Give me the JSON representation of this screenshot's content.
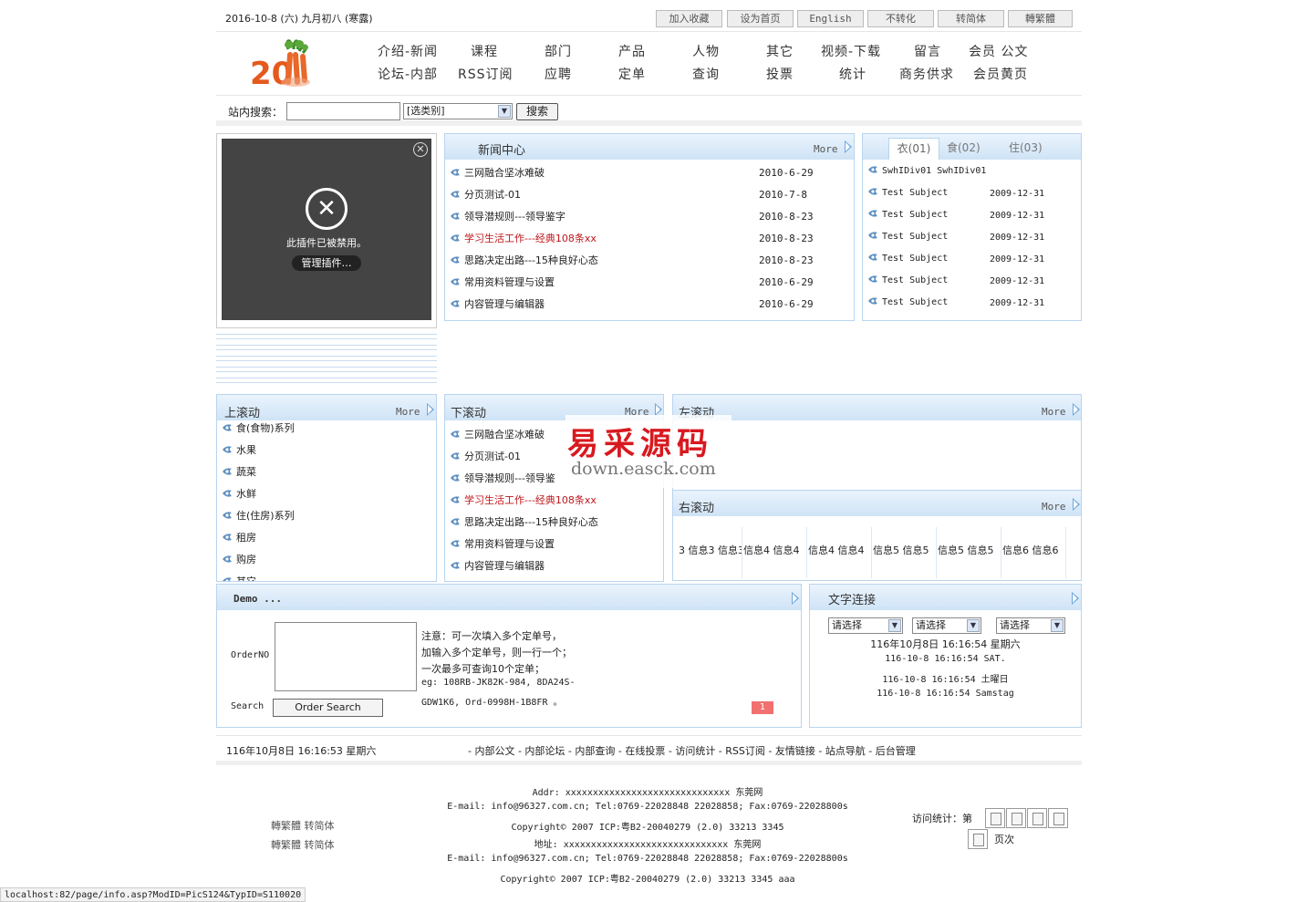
{
  "top": {
    "date": "2016-10-8 (六)  九月初八 (寒露)",
    "buttons": [
      "加入收藏",
      "设为首页",
      "English",
      "不转化",
      "转简体",
      "轉繁體"
    ]
  },
  "nav": {
    "row1": [
      "介绍-新闻",
      "课程",
      "部门",
      "产品",
      "人物",
      "其它",
      "视频-下载",
      "留言",
      "会员  公文"
    ],
    "row2": [
      "论坛-内部",
      "RSS订阅",
      "应聘",
      "定单",
      "查询",
      "投票",
      "统计",
      "商务供求",
      "会员黄页"
    ]
  },
  "search": {
    "label": "站内搜索：",
    "select": "[选类别]",
    "button": "搜索"
  },
  "plugin": {
    "message": "此插件已被禁用。",
    "manage": "管理插件…"
  },
  "news": {
    "title": "新闻中心",
    "more": "More",
    "items": [
      {
        "text": "三网融合坚冰难破",
        "date": "2010-6-29",
        "red": false
      },
      {
        "text": "分页测试-01",
        "date": "2010-7-8",
        "red": false
      },
      {
        "text": "领导潜规则---领导鉴字",
        "date": "2010-8-23",
        "red": false
      },
      {
        "text": "学习生活工作---经典108条xx",
        "date": "2010-8-23",
        "red": true
      },
      {
        "text": "思路决定出路---15种良好心态",
        "date": "2010-8-23",
        "red": false
      },
      {
        "text": "常用资料管理与设置",
        "date": "2010-6-29",
        "red": false
      },
      {
        "text": "内容管理与编辑器",
        "date": "2010-6-29",
        "red": false
      }
    ]
  },
  "tabs": {
    "labels": [
      "衣(01)",
      "食(02)",
      "住(03)"
    ],
    "items": [
      {
        "text": "SwhIDiv01 SwhIDiv01",
        "date": ""
      },
      {
        "text": "Test Subject",
        "date": "2009-12-31"
      },
      {
        "text": "Test Subject",
        "date": "2009-12-31"
      },
      {
        "text": "Test Subject",
        "date": "2009-12-31"
      },
      {
        "text": "Test Subject",
        "date": "2009-12-31"
      },
      {
        "text": "Test Subject",
        "date": "2009-12-31"
      },
      {
        "text": "Test Subject",
        "date": "2009-12-31"
      }
    ]
  },
  "scroll_up": {
    "title": "上滚动",
    "more": "More",
    "items": [
      "食(食物)系列",
      "水果",
      "蔬菜",
      "水鲜",
      "住(住房)系列",
      "租房",
      "购房",
      "其它"
    ]
  },
  "scroll_down": {
    "title": "下滚动",
    "more": "More",
    "items": [
      {
        "text": "三网融合坚冰难破",
        "red": false
      },
      {
        "text": "分页测试-01",
        "red": false
      },
      {
        "text": "领导潜规则---领导鉴",
        "red": false
      },
      {
        "text": "学习生活工作---经典108条xx",
        "red": true
      },
      {
        "text": "思路决定出路---15种良好心态",
        "red": false
      },
      {
        "text": "常用资料管理与设置",
        "red": false
      },
      {
        "text": "内容管理与编辑器",
        "red": false
      }
    ]
  },
  "watermark": {
    "cn": "易采源码",
    "en": "down.easck.com"
  },
  "scroll_left": {
    "title": "左滚动",
    "more": "More"
  },
  "scroll_right": {
    "title": "右滚动",
    "more": "More",
    "items": [
      "3 信息3 信息3",
      "信息4 信息4",
      "信息4 信息4",
      "信息5 信息5",
      "信息5 信息5",
      "信息6 信息6"
    ]
  },
  "demo": {
    "title": "Demo ...",
    "order_label": "OrderNO",
    "search_label": "Search",
    "button": "Order Search",
    "notes": [
      "注意：可一次填入多个定单号，",
      "加输入多个定单号，则一行一个；",
      "一次最多可查询10个定单；",
      "eg: 108RB-JK82K-984, 8DA24S-",
      "GDW1K6, Ord-0998H-1B8FR 。"
    ],
    "badge": "1"
  },
  "links": {
    "title": "文字连接",
    "selects": [
      "请选择",
      "请选择",
      "请选择"
    ],
    "times": [
      "116年10月8日  16:16:54  星期六",
      "116-10-8  16:16:54 SAT.",
      "116-10-8  16:16:54 土曜日",
      "116-10-8  16:16:54 Samstag"
    ]
  },
  "bottom": {
    "time": "116年10月8日  16:16:53  星期六",
    "links": "- 内部公文 - 内部论坛 - 内部查询 - 在线投票 - 访问统计 - RSS订阅 - 友情链接 - 站点导航 - 后台管理"
  },
  "footer": {
    "lines": [
      "Addr: xxxxxxxxxxxxxxxxxxxxxxxxxxxxxx 东莞网",
      "E-mail: info@96327.com.cn; Tel:0769-22028848 22028858; Fax:0769-22028800s",
      "Copyright© 2007 ICP:粤B2-20040279 (2.0) 33213 3345",
      "地址: xxxxxxxxxxxxxxxxxxxxxxxxxxxxxx 东莞网",
      "E-mail: info@96327.com.cn; Tel:0769-22028848 22028858; Fax:0769-22028800s",
      "Copyright© 2007 ICP:粤B2-20040279 (2.0) 33213 3345 aaa"
    ],
    "lang1": "轉繁體 转简体",
    "lang2": "轉繁體 转简体",
    "visit_label": "访问统计：第",
    "visit_suffix": "页次"
  },
  "statusbar": "localhost:82/page/info.asp?ModID=PicS124&TypID=S110020"
}
